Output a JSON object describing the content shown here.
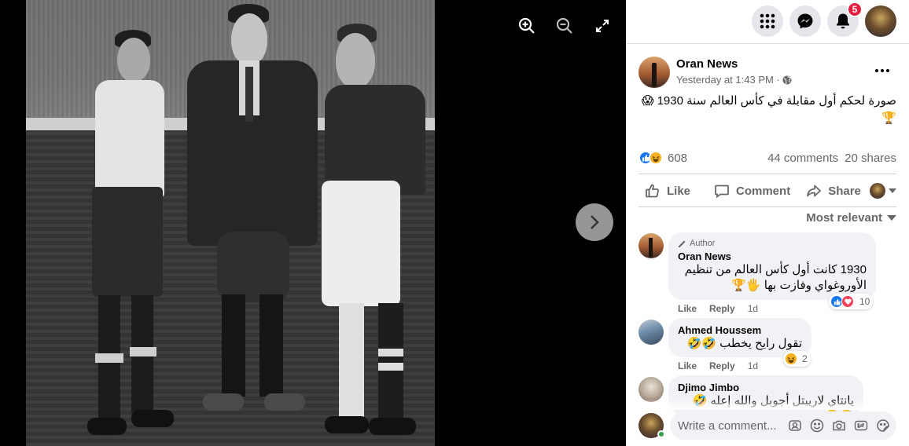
{
  "viewer": {
    "zoom_in_icon": "zoom-in-icon",
    "zoom_out_icon": "zoom-out-icon",
    "fullscreen_icon": "fullscreen-icon",
    "next_icon": "chevron-right-icon"
  },
  "topbar": {
    "menu_icon": "grid-menu-icon",
    "messenger_icon": "messenger-icon",
    "notifications_icon": "bell-icon",
    "notification_count": "5"
  },
  "post": {
    "author": "Oran News",
    "time": "Yesterday at 1:43 PM ·",
    "privacy_icon": "globe-icon",
    "text_line1": "صورة لحكم أول مقابلة في كأس العالم سنة 1930 😱",
    "text_line2": "🏆",
    "reaction_count": "608",
    "comments": "44 comments",
    "shares": "20 shares",
    "actions": {
      "like": "Like",
      "comment": "Comment",
      "share": "Share"
    },
    "sort_label": "Most relevant"
  },
  "comments": [
    {
      "author_tag": "Author",
      "name": "Oran News",
      "text_line1": "1930 كانت أول كأس العالم من تنظيم",
      "text_line2": "الأوروغواي وفازت بها 🖐🏆",
      "like": "Like",
      "reply": "Reply",
      "time": "1d",
      "reaction_count": "10"
    },
    {
      "name": "Ahmed Houssem",
      "text_line1": "تقول رايح يخطب 🤣🤣🤣",
      "like": "Like",
      "reply": "Reply",
      "time": "1d",
      "reaction_count": "2"
    },
    {
      "name": "Djimo Jimbo",
      "text_line1": "يانتاي لاريبتل أجوبل والله إعله 🤣🤣🤣"
    }
  ],
  "composer": {
    "placeholder": "Write a comment..."
  },
  "colors": {
    "like_blue": "#1877f2",
    "love_red": "#f33e58",
    "badge_red": "#e41e3f",
    "text_secondary": "#65676b"
  }
}
